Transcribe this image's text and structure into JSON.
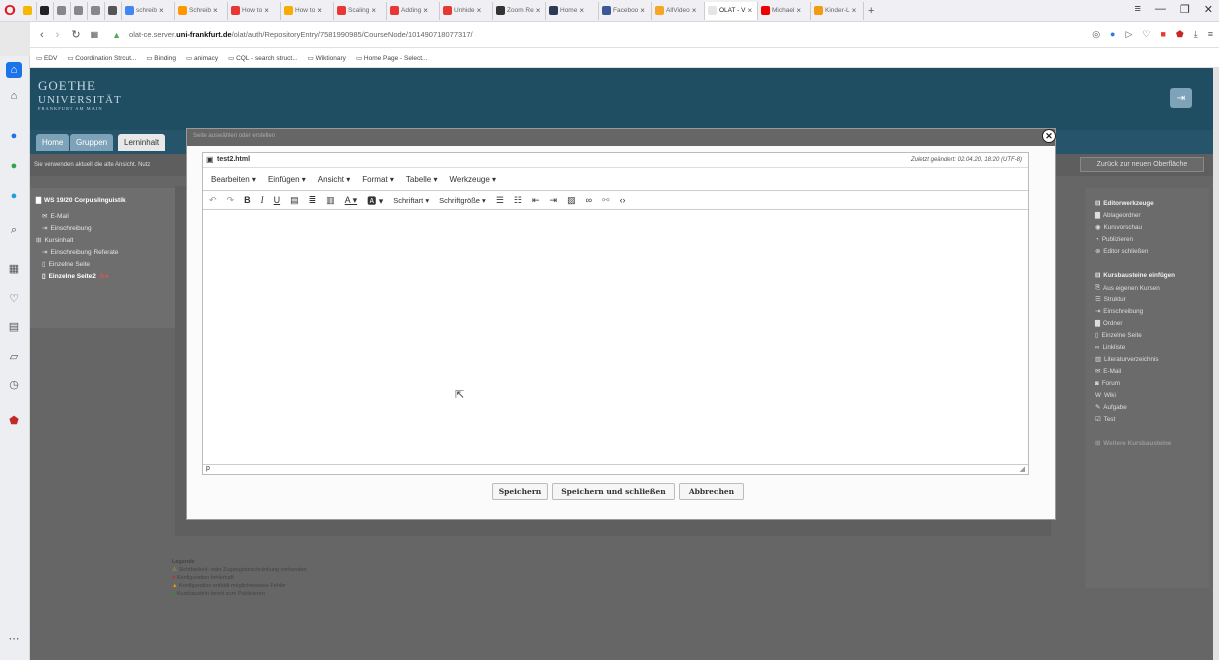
{
  "tabs": [
    {
      "label": "",
      "color": "#f5b800"
    },
    {
      "label": "",
      "color": "#222"
    },
    {
      "label": "",
      "color": "#888"
    },
    {
      "label": "",
      "color": "#888"
    },
    {
      "label": "",
      "color": "#888"
    },
    {
      "label": "",
      "color": "#555"
    },
    {
      "label": "schreib",
      "color": "#4285f4"
    },
    {
      "label": "Schreib",
      "color": "#ff9800"
    },
    {
      "label": "How to",
      "color": "#e53935"
    },
    {
      "label": "How to",
      "color": "#f9ab00"
    },
    {
      "label": "Scaling",
      "color": "#e53935"
    },
    {
      "label": "Adding",
      "color": "#e53935"
    },
    {
      "label": "Unhide",
      "color": "#e53935"
    },
    {
      "label": "Zoom Re",
      "color": "#333"
    },
    {
      "label": "Home",
      "color": "#2b3a55"
    },
    {
      "label": "Faceboo",
      "color": "#3b5998"
    },
    {
      "label": "AllVideo",
      "color": "#f5a623"
    },
    {
      "label": "OLAT - V",
      "color": "#e5e5e5",
      "active": true
    },
    {
      "label": "Michael",
      "color": "#e00"
    },
    {
      "label": "Kinder-L",
      "color": "#f39c12"
    }
  ],
  "url": {
    "prefix": "olat-ce.server.",
    "domain": "uni-frankfurt.de",
    "path": "/olat/auth/RepositoryEntry/7581990985/CourseNode/101490718077317/"
  },
  "bookmarks": [
    "EDV",
    "Coordination Strcut...",
    "Binding",
    "animacy",
    "CQL - search struct...",
    "Wiktionary",
    "Home Page - Select..."
  ],
  "logo": {
    "line1": "GOETHE",
    "line2": "UNIVERSITÄT",
    "line3": "FRANKFURT AM MAIN"
  },
  "nav": {
    "home": "Home",
    "groups": "Gruppen",
    "learn": "Lerninhalt"
  },
  "info": "Sie verwenden aktuell die alte Ansicht. Nutz",
  "back_new": "Zurück zur neuen Oberfläche",
  "course": {
    "title": "WS 19/20 Corpuslinguistik",
    "items": [
      "E-Mail",
      "Einschreibung",
      "Kursinhalt",
      "Einschreibung Referate",
      "Einzelne Seite",
      "Einzelne Seite2"
    ]
  },
  "right_panel": {
    "tools_title": "Editorwerkzeuge",
    "tools": [
      "Ablageordner",
      "Kursvorschau",
      "Publizieren",
      "Editor schließen"
    ],
    "insert_title": "Kursbausteine einfügen",
    "insert": [
      "Aus eigenen Kursen",
      "Struktur",
      "Einschreibung",
      "Ordner",
      "Einzelne Seite",
      "Linkliste",
      "Literaturverzeichnis",
      "E-Mail",
      "Forum",
      "Wiki",
      "Aufgabe",
      "Test"
    ],
    "more": "Weitere Kursbausteine"
  },
  "legend": {
    "title": "Legende",
    "items": [
      "Sichtbarkeit- oder Zugangsbeschränkung vorhanden",
      "Konfiguration fehlerhaft",
      "Konfiguration enthält möglicherweise Fehler",
      "Kursbaustein bereit zum Publizieren"
    ]
  },
  "modal": {
    "header": "Seite auswählen oder erstellen",
    "filename": "test2.html",
    "modified": "Zuletzt geändert: 02.04.20, 18:20   (UTF-8)",
    "menus": [
      "Bearbeiten",
      "Einfügen",
      "Ansicht",
      "Format",
      "Tabelle",
      "Werkzeuge"
    ],
    "font": "Schriftart",
    "size": "Schriftgröße",
    "status_path": "p",
    "save": "Speichern",
    "save_close": "Speichern und schließen",
    "cancel": "Abbrechen"
  }
}
